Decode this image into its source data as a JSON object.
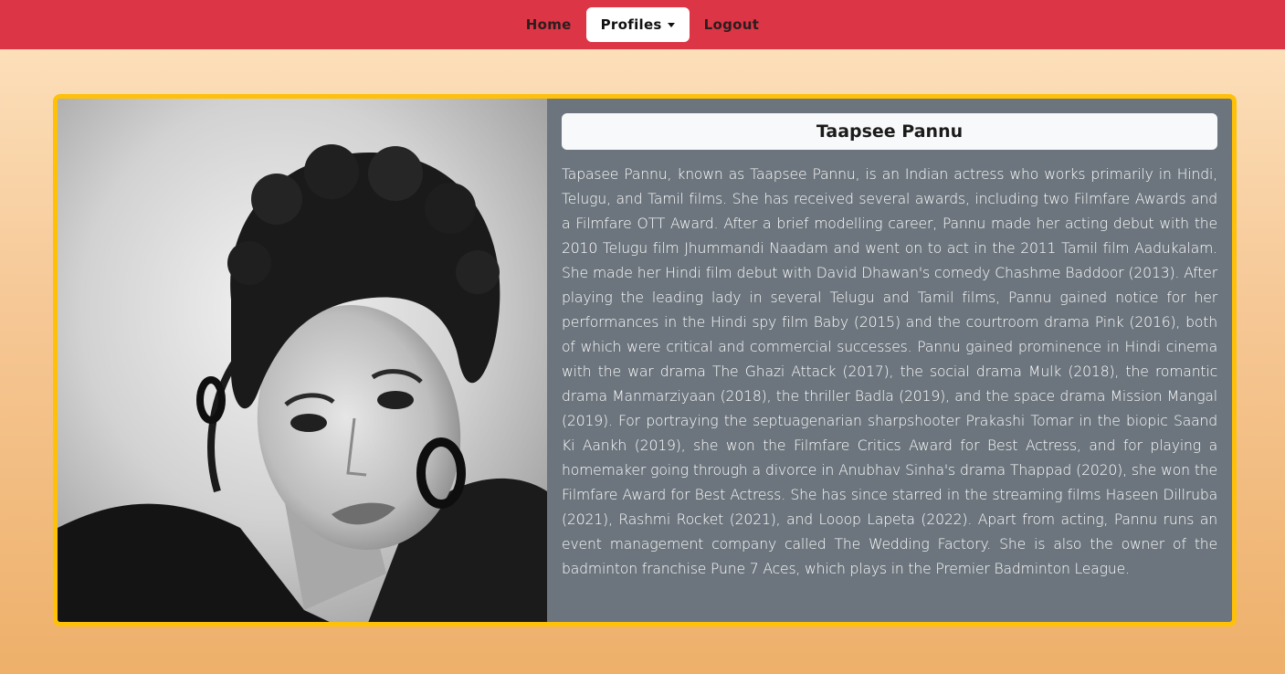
{
  "nav": {
    "items": [
      {
        "label": "Home",
        "active": false
      },
      {
        "label": "Profiles",
        "active": true,
        "dropdown": true
      },
      {
        "label": "Logout",
        "active": false
      }
    ]
  },
  "profile": {
    "name": "Taapsee Pannu",
    "bio": "Tapasee Pannu, known as Taapsee Pannu, is an Indian actress who works primarily in Hindi, Telugu, and Tamil films. She has received several awards, including two Filmfare Awards and a Filmfare OTT Award. After a brief modelling career, Pannu made her acting debut with the 2010 Telugu film Jhummandi Naadam and went on to act in the 2011 Tamil film Aadukalam. She made her Hindi film debut with David Dhawan's comedy Chashme Baddoor (2013). After playing the leading lady in several Telugu and Tamil films, Pannu gained notice for her performances in the Hindi spy film Baby (2015) and the courtroom drama Pink (2016), both of which were critical and commercial successes. Pannu gained prominence in Hindi cinema with the war drama The Ghazi Attack (2017), the social drama Mulk (2018), the romantic drama Manmarziyaan (2018), the thriller Badla (2019), and the space drama Mission Mangal (2019). For portraying the septuagenarian sharpshooter Prakashi Tomar in the biopic Saand Ki Aankh (2019), she won the Filmfare Critics Award for Best Actress, and for playing a homemaker going through a divorce in Anubhav Sinha's drama Thappad (2020), she won the Filmfare Award for Best Actress. She has since starred in the streaming films Haseen Dillruba (2021), Rashmi Rocket (2021), and Looop Lapeta (2022). Apart from acting, Pannu runs an event management company called The Wedding Factory. She is also the owner of the badminton franchise Pune 7 Aces, which plays in the Premier Badminton League."
  },
  "colors": {
    "navbar": "#dc3545",
    "card_border": "#ffc107",
    "card_bg": "#6c757d",
    "name_box_bg": "#f8f9fa"
  }
}
